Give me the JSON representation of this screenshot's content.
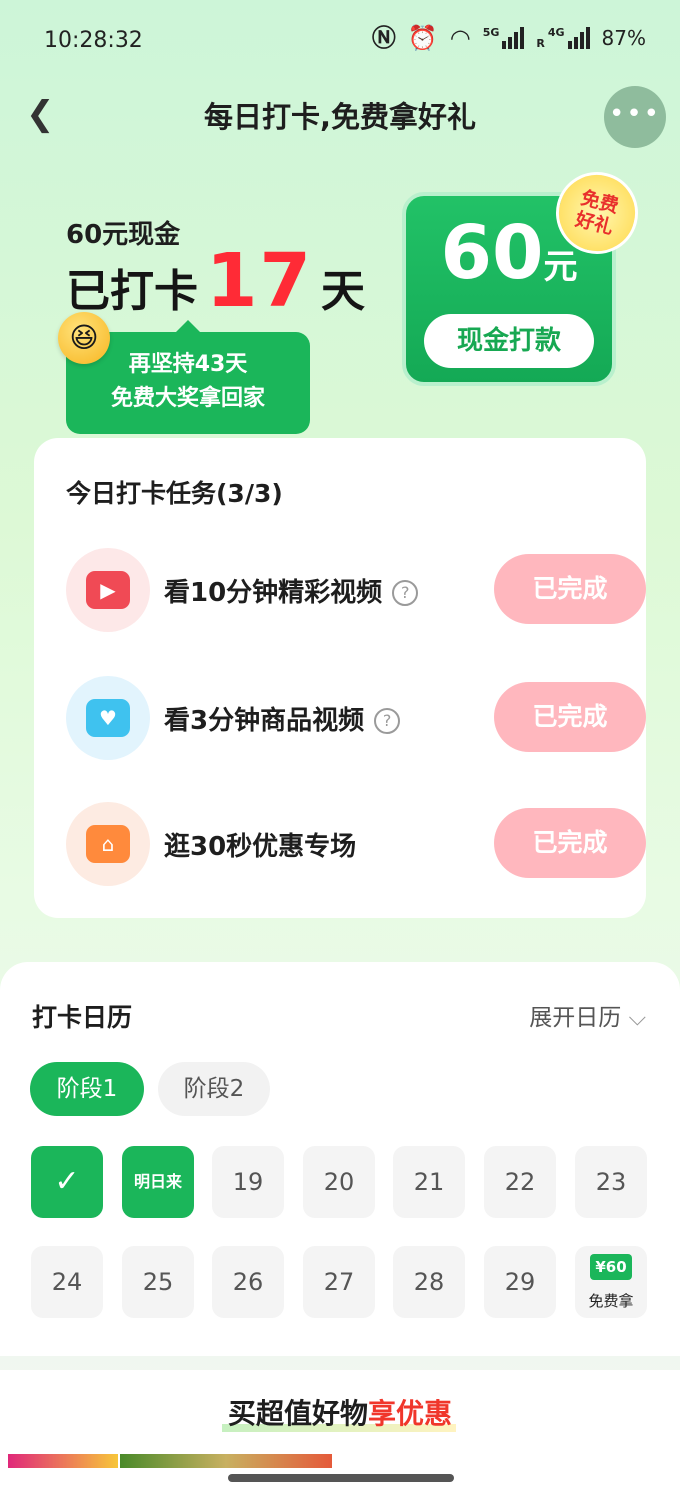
{
  "status_bar": {
    "time": "10:28:32",
    "net1": "5G",
    "net2": "4G",
    "net2_sub": "R",
    "battery": "87%"
  },
  "header": {
    "title": "每日打卡,免费拿好礼",
    "more_label": "•••"
  },
  "hero": {
    "cash_label": "60元现金",
    "checked_prefix": "已打卡",
    "checked_days": "17",
    "checked_suffix": "天",
    "tip_line1": "再坚持43天",
    "tip_line2": "免费大奖拿回家",
    "card_amount": "60",
    "card_unit": "元",
    "card_button": "现金打款",
    "badge_line1": "免费",
    "badge_line2": "好礼"
  },
  "tasks": {
    "title": "今日打卡任务(3/3)",
    "items": [
      {
        "label": "看10分钟精彩视频",
        "has_help": true,
        "status": "已完成",
        "icon": "tv-icon",
        "icon_bg": "#fde8e8",
        "icon_color": "#f04a55"
      },
      {
        "label": "看3分钟商品视频",
        "has_help": true,
        "status": "已完成",
        "icon": "video-camera-icon",
        "icon_bg": "#e2f4fd",
        "icon_color": "#3fc2ef"
      },
      {
        "label": "逛30秒优惠专场",
        "has_help": false,
        "status": "已完成",
        "icon": "store-icon",
        "icon_bg": "#fdebe2",
        "icon_color": "#ff8a3c"
      }
    ],
    "help_symbol": "?"
  },
  "calendar": {
    "title": "打卡日历",
    "expand_label": "展开日历",
    "stages": [
      "阶段1",
      "阶段2"
    ],
    "day_check": "✓",
    "tomorrow_label": "明日来",
    "days_row1": [
      "19",
      "20",
      "21",
      "22",
      "23"
    ],
    "days_row2": [
      "24",
      "25",
      "26",
      "27",
      "28",
      "29"
    ],
    "reward_amount": "¥60",
    "reward_label": "免费拿"
  },
  "promo": {
    "part1": "买超值好物",
    "part2": "享优惠"
  },
  "colors": {
    "accent_green": "#1bb65a",
    "highlight_red": "#ff2b36",
    "done_pink": "#ffb7be"
  }
}
